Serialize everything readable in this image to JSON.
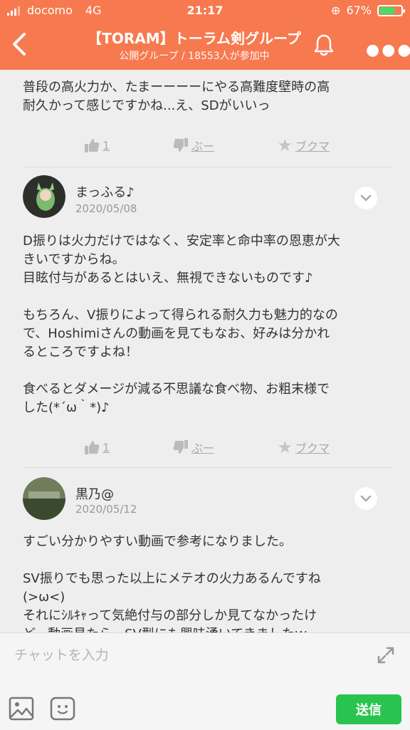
{
  "status": {
    "carrier": "docomo",
    "network": "4G",
    "time": "21:17",
    "battery": "67%",
    "battery_level": 0.67
  },
  "header": {
    "title": "【TORAM】トーラム剣グループ",
    "subtitle": "公開グループ / 18553人が参加中"
  },
  "posts": [
    {
      "body": "普段の高火力か、たまーーーーにやる高難度壁時の高\n耐久かって感じですかね...え、SDがいいっ",
      "likes": "1",
      "boo": "ぶー",
      "bookmark": "ブクマ"
    },
    {
      "name": "まっふる♪",
      "date": "2020/05/08",
      "body": "D振りは火力だけではなく、安定率と命中率の恩恵が大\nきいですからね。\n目眩付与があるとはいえ、無視できないものです♪\n\nもちろん、V振りによって得られる耐久力も魅力的なの\nで、Hoshimiさんの動画を見てもなお、好みは分かれ\nるところですよね！\n\n食べるとダメージが減る不思議な食べ物、お粗末様で\nした(*´ω｀*)♪",
      "likes": "1",
      "boo": "ぶー",
      "bookmark": "ブクマ"
    },
    {
      "name": "黒乃@",
      "date": "2020/05/12",
      "body": "すごい分かりやすい動画で参考になりました。\n\nSV振りでも思った以上にメテオの火力あるんですね\n(>ω<)\nそれにｼﾙｷｬって気絶付与の部分しか見てなかったけ\nど、動画見たら、SV型にも興味湧いてきましたｗ"
    }
  ],
  "input": {
    "placeholder": "チャットを入力",
    "send": "送信"
  },
  "colors": {
    "header": "#f7794f",
    "send": "#29c450"
  }
}
